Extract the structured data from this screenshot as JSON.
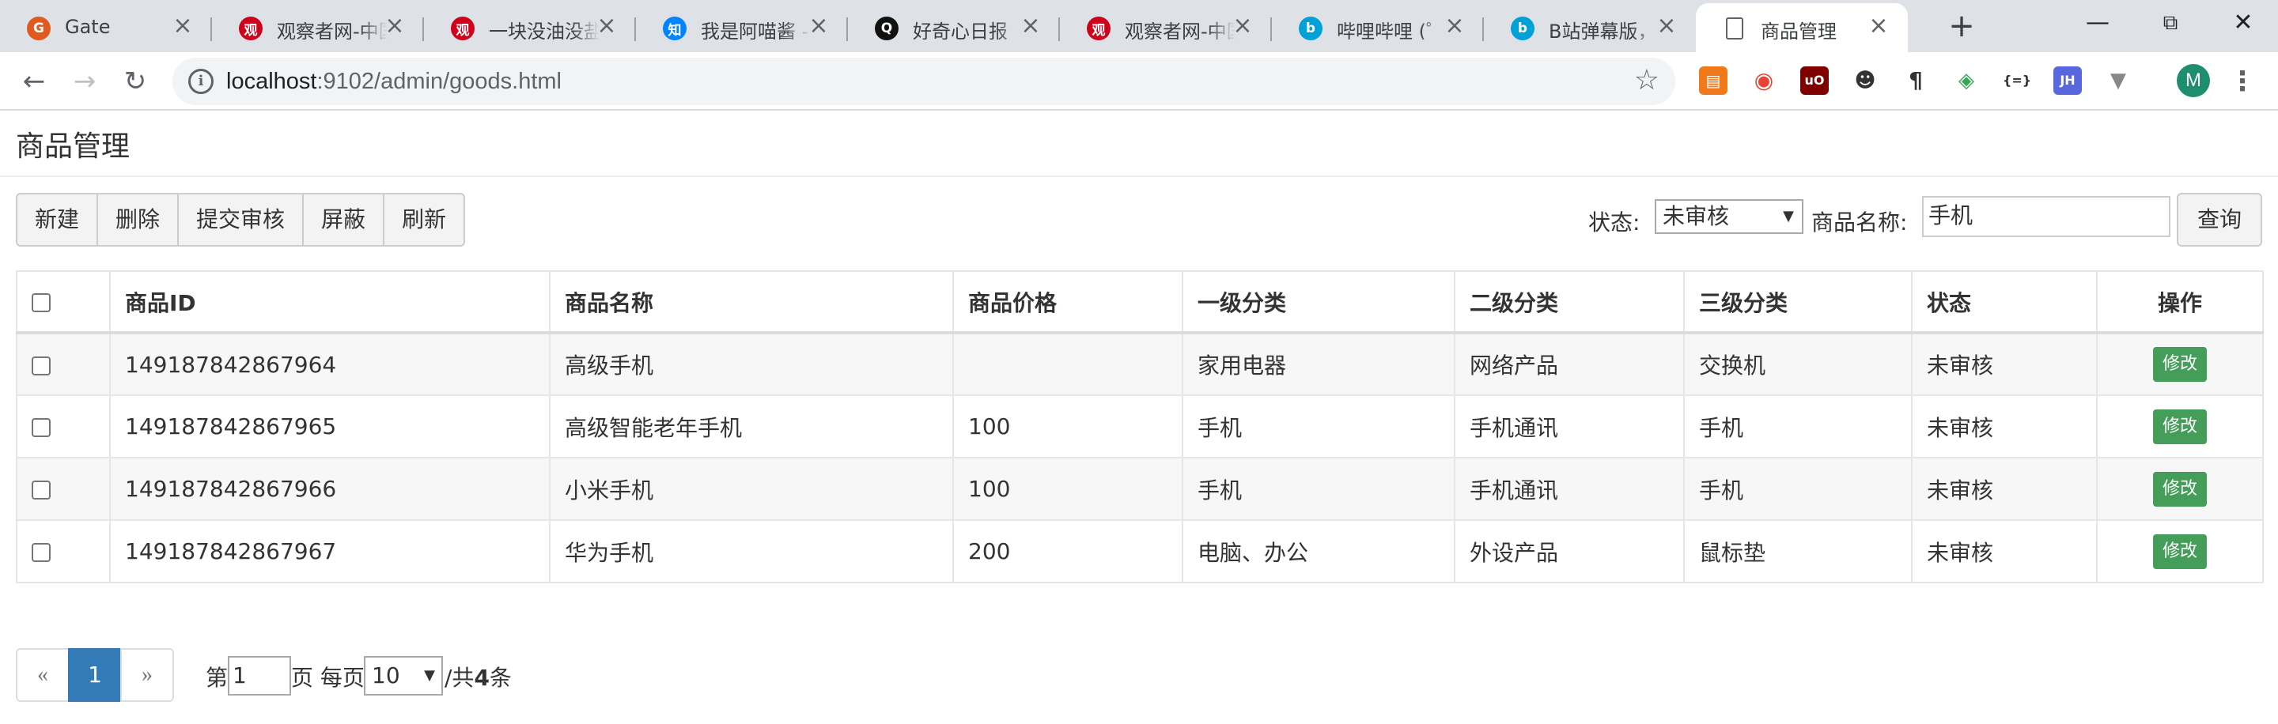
{
  "browser": {
    "tabs": [
      {
        "title": "Gate",
        "icon": "gate-favicon-icon",
        "color": "#e05a1f",
        "glyph": "G"
      },
      {
        "title": "观察者网-中国",
        "icon": "guancha-favicon-icon",
        "color": "#d0021b",
        "glyph": "观"
      },
      {
        "title": "一块没油没盐",
        "icon": "guancha-favicon-icon",
        "color": "#d0021b",
        "glyph": "观"
      },
      {
        "title": "我是阿喵酱 -",
        "icon": "zhihu-favicon-icon",
        "color": "#0084ff",
        "glyph": "知"
      },
      {
        "title": "好奇心日报_",
        "icon": "qdaily-favicon-icon",
        "color": "#111111",
        "glyph": "Q"
      },
      {
        "title": "观察者网-中国",
        "icon": "guancha-favicon-icon",
        "color": "#d0021b",
        "glyph": "观"
      },
      {
        "title": "哔哩哔哩 (゜",
        "icon": "bilibili-favicon-icon",
        "color": "#00a1d6",
        "glyph": "b"
      },
      {
        "title": "B站弹幕版，",
        "icon": "bilibili-favicon-icon",
        "color": "#00a1d6",
        "glyph": "b"
      },
      {
        "title": "商品管理",
        "icon": "page-favicon-icon",
        "color": "#ffffff",
        "glyph": ""
      }
    ],
    "url_host": "localhost",
    "url_rest": ":9102/admin/goods.html"
  },
  "page": {
    "title": "商品管理"
  },
  "toolbar": {
    "new_label": "新建",
    "delete_label": "删除",
    "submit_label": "提交审核",
    "block_label": "屏蔽",
    "refresh_label": "刷新"
  },
  "search": {
    "status_label": "状态:",
    "status_value": "未审核",
    "name_label": "商品名称:",
    "name_value": "手机",
    "query_label": "查询"
  },
  "table": {
    "headers": [
      "商品ID",
      "商品名称",
      "商品价格",
      "一级分类",
      "二级分类",
      "三级分类",
      "状态",
      "操作"
    ],
    "rows": [
      {
        "id": "149187842867964",
        "name": "高级手机",
        "price": "",
        "cat1": "家用电器",
        "cat2": "网络产品",
        "cat3": "交换机",
        "status": "未审核",
        "action": "修改"
      },
      {
        "id": "149187842867965",
        "name": "高级智能老年手机",
        "price": "100",
        "cat1": "手机",
        "cat2": "手机通讯",
        "cat3": "手机",
        "status": "未审核",
        "action": "修改"
      },
      {
        "id": "149187842867966",
        "name": "小米手机",
        "price": "100",
        "cat1": "手机",
        "cat2": "手机通讯",
        "cat3": "手机",
        "status": "未审核",
        "action": "修改"
      },
      {
        "id": "149187842867967",
        "name": "华为手机",
        "price": "200",
        "cat1": "电脑、办公",
        "cat2": "外设产品",
        "cat3": "鼠标垫",
        "status": "未审核",
        "action": "修改"
      }
    ]
  },
  "pagination": {
    "prev": "«",
    "current": "1",
    "next": "»",
    "page_prefix": "第",
    "page_value": "1",
    "page_suffix": "页 每页",
    "size_value": "10",
    "total_prefix": "/共",
    "total_count": "4",
    "total_suffix": "条"
  },
  "colors": {
    "primary": "#337ab7",
    "edit_button": "#449d59"
  }
}
